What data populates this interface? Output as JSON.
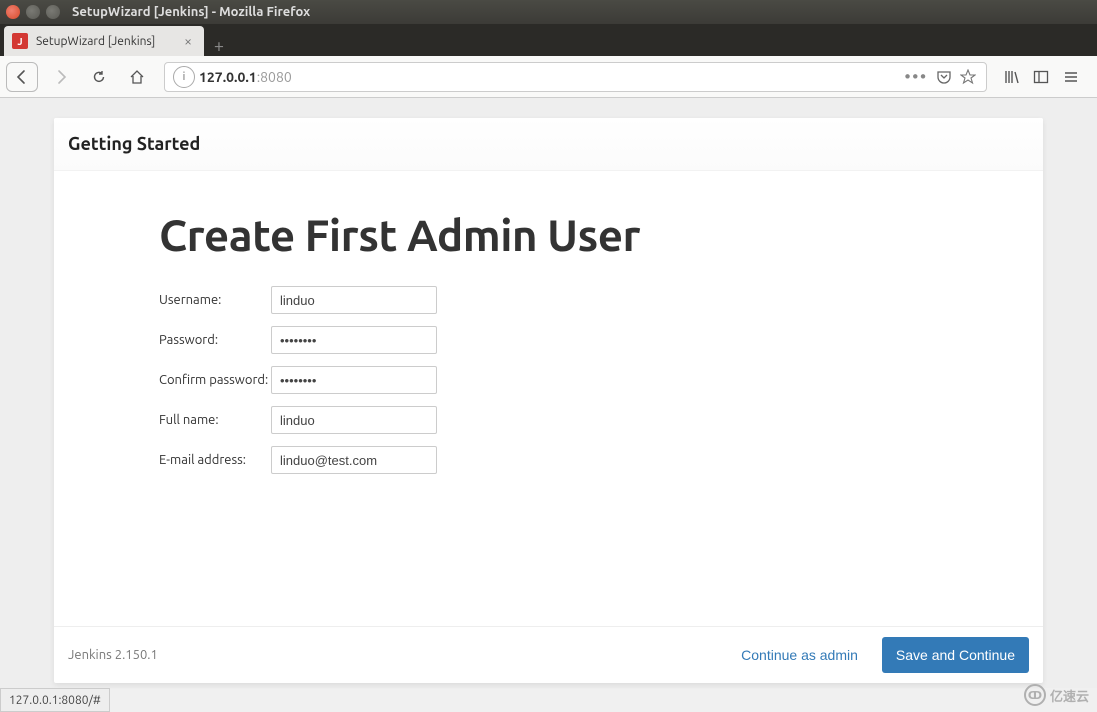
{
  "os": {
    "window_title": "SetupWizard [Jenkins] - Mozilla Firefox"
  },
  "browser": {
    "tab_title": "SetupWizard [Jenkins]",
    "url_host": "127.0.0.1",
    "url_port": ":8080"
  },
  "wizard": {
    "header": "Getting Started",
    "title": "Create First Admin User",
    "fields": {
      "username_label": "Username:",
      "username_value": "linduo",
      "password_label": "Password:",
      "password_value": "••••••••",
      "confirm_label": "Confirm password:",
      "confirm_value": "••••••••",
      "fullname_label": "Full name:",
      "fullname_value": "linduo",
      "email_label": "E-mail address:",
      "email_value": "linduo@test.com"
    },
    "footer": {
      "version": "Jenkins 2.150.1",
      "continue_admin": "Continue as admin",
      "save_continue": "Save and Continue"
    }
  },
  "status_bar": "127.0.0.1:8080/#",
  "watermark": "亿速云"
}
